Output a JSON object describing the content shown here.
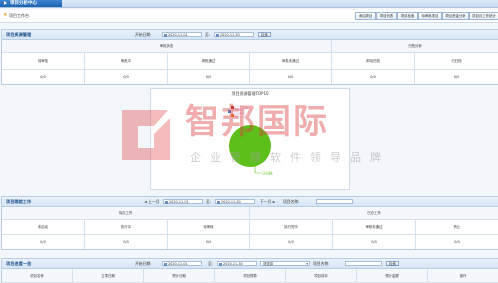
{
  "window": {
    "tab_title": "项目分析中心"
  },
  "toolbar": {
    "title": "项目工作台",
    "buttons": [
      "添加项目",
      "项目列表",
      "项目检索",
      "待审批项目",
      "项目资金分析",
      "项目月工作统计"
    ]
  },
  "panel1": {
    "title": "项目资源管理",
    "start_label": "开始日期:",
    "start_date": "2020-11-01",
    "to_label": "至:",
    "end_date": "2020-11-30",
    "search_btn": "检索",
    "group_status": "审批状态",
    "group_archive": "归档分析",
    "columns": [
      "待审批",
      "审批中",
      "审批通过",
      "审批未通过",
      "即将归档",
      "已归档"
    ],
    "values": [
      "0/0",
      "0/0",
      "0/0",
      "0/0",
      "0/0",
      "0/0"
    ]
  },
  "chart_card": {
    "title": "项目资源管理TOP10",
    "slice_label": "已归档"
  },
  "panel2": {
    "title": "项目跟踪工作",
    "prev_month": "上一月",
    "start_date": "2020-11-01",
    "to_label": "至:",
    "end_date": "2020-11-30",
    "next_month": "下一月",
    "name_label": "项目名称:",
    "name_value": "",
    "group_todo": "待办工作",
    "group_done": "已办工作",
    "columns": [
      "未启动",
      "执行中",
      "待审核",
      "执行完毕",
      "审核未通过",
      "终止"
    ],
    "values": [
      "0/0",
      "0/0",
      "0/0",
      "0/0",
      "0/0",
      "0/0"
    ]
  },
  "panel3": {
    "title": "项目进度一览",
    "start_label": "开始日期:",
    "start_date": "2020-11-01",
    "to_label": "至:",
    "end_date": "2020-11-30",
    "select_value": "请选择",
    "name_label": "项目名称:",
    "name_value": "",
    "search_btn": "检索",
    "columns": [
      "项目名称",
      "立项日期",
      "预计日期",
      "项目预算",
      "项目成本",
      "预计金额",
      "操作"
    ]
  },
  "watermark": {
    "text_main": "智邦国际",
    "text_sub": "企业管理软件领导品牌"
  },
  "colors": {
    "accent": "#2a6fbd",
    "pie": "#5dbf1a",
    "watermark": "#d9443f"
  },
  "chart_data": {
    "type": "pie",
    "title": "项目资源管理TOP10",
    "categories": [
      "已归档"
    ],
    "values": [
      1
    ]
  }
}
